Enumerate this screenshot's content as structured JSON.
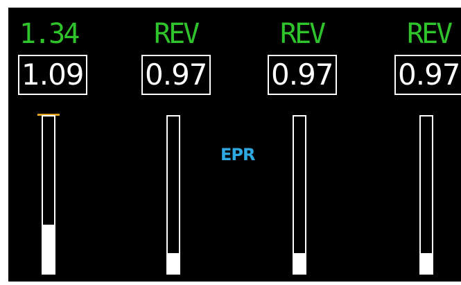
{
  "display": {
    "parameter_label": "EPR",
    "colors": {
      "background": "#000000",
      "target_text": "#2fc42c",
      "readout_text": "#ffffff",
      "parameter_label": "#2ea8e0",
      "command_marker": "#e0a020"
    }
  },
  "engines": [
    {
      "target": "1.34",
      "readout": "1.09",
      "gauge_fraction": 0.31,
      "command_marker": true
    },
    {
      "target": "REV",
      "readout": "0.97",
      "gauge_fraction": 0.13,
      "command_marker": false
    },
    {
      "target": "REV",
      "readout": "0.97",
      "gauge_fraction": 0.13,
      "command_marker": false
    },
    {
      "target": "REV",
      "readout": "0.97",
      "gauge_fraction": 0.13,
      "command_marker": false
    }
  ]
}
